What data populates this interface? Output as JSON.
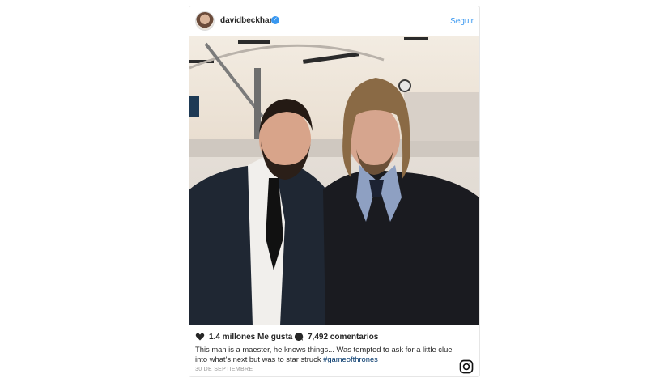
{
  "post": {
    "username": "davidbeckham",
    "follow_label": "Seguir",
    "likes": "1.4 millones Me gusta",
    "comments": "7,492 comentarios",
    "caption_text": "This man is a maester, he knows things... Was tempted to ask for a little clue into what's next but was to star struck ",
    "hashtag": "#gameofthrones",
    "date": "30 DE SEPTIEMBRE"
  },
  "colors": {
    "link_blue": "#3897f0",
    "hashtag": "#003569",
    "text": "#262626",
    "muted": "#999999"
  },
  "icons": [
    "verified-badge-icon",
    "heart-icon",
    "comment-icon",
    "instagram-logo-icon"
  ]
}
